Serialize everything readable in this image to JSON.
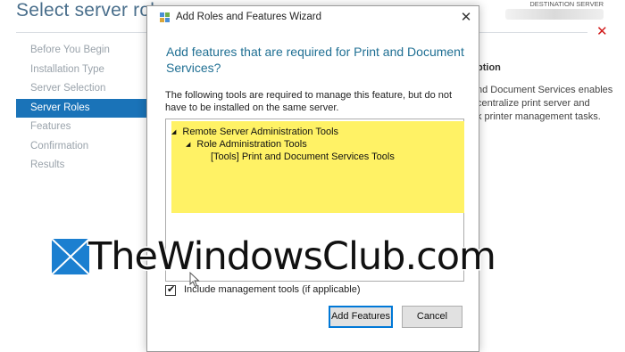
{
  "background": {
    "page_title": "Select server roles",
    "destination_label": "DESTINATION SERVER",
    "nav": [
      {
        "label": "Before You Begin",
        "active": false
      },
      {
        "label": "Installation Type",
        "active": false
      },
      {
        "label": "Server Selection",
        "active": false
      },
      {
        "label": "Server Roles",
        "active": true
      },
      {
        "label": "Features",
        "active": false
      },
      {
        "label": "Confirmation",
        "active": false
      },
      {
        "label": "Results",
        "active": false
      }
    ],
    "description_heading": "ption",
    "description_lines": [
      "nd Document Services enables",
      "centralize print server and",
      "k printer management tasks."
    ],
    "close_symbol": "✕"
  },
  "dialog": {
    "title": "Add Roles and Features Wizard",
    "close_symbol": "✕",
    "heading": "Add features that are required for Print and Document Services?",
    "body": "The following tools are required to manage this feature, but do not have to be installed on the same server.",
    "tree": [
      {
        "label": "Remote Server Administration Tools",
        "level": 0,
        "expandable": true
      },
      {
        "label": "Role Administration Tools",
        "level": 1,
        "expandable": true
      },
      {
        "label": "[Tools] Print and Document Services Tools",
        "level": 2,
        "expandable": false
      }
    ],
    "tree_arrow": "◢",
    "checkbox_label": "Include management tools (if applicable)",
    "checkbox_checked": true,
    "check_mark": "✔",
    "buttons": {
      "add": "Add Features",
      "cancel": "Cancel"
    },
    "highlight_color": "#fff265"
  },
  "watermark": {
    "text": "TheWindowsClub.com"
  },
  "colors": {
    "accent": "#1a73b8",
    "heading": "#1f6f93",
    "close_red": "#d11a1a"
  }
}
